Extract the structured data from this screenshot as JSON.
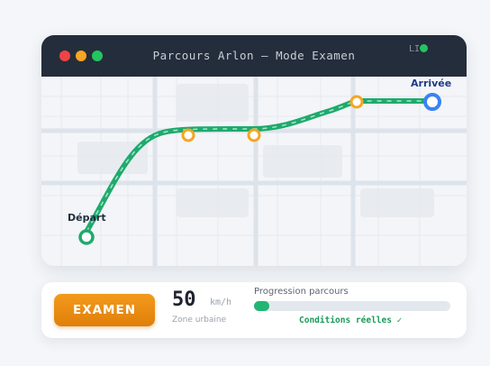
{
  "window": {
    "title": "Parcours Arlon — Mode Examen",
    "live_label": "LI",
    "controls": {
      "close_color": "#ef4444",
      "minimize_color": "#f5a623",
      "maximize_color": "#22c55e"
    }
  },
  "map": {
    "start_label": "Départ",
    "end_label": "Arrivée",
    "route_color": "#1faa6e",
    "waypoint_color": "#f5a623",
    "end_color": "#3b82f6"
  },
  "panel": {
    "exam_button": "EXAMEN",
    "speed_value": "50",
    "speed_unit": "km/h",
    "zone": "Zone urbaine",
    "progress_label": "Progression parcours",
    "progress_fraction": 0.08,
    "conditions": "Conditions réelles ✓"
  }
}
